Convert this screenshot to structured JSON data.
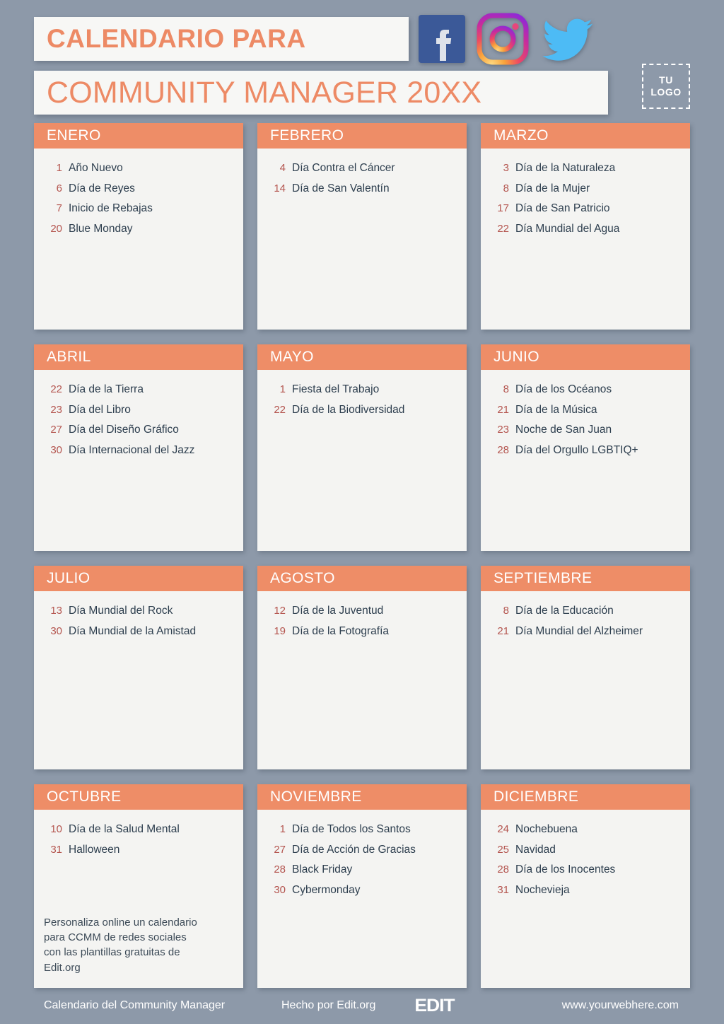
{
  "header": {
    "title_line1": "CALENDARIO PARA",
    "title_line2": "COMMUNITY MANAGER 20XX",
    "logo_line1": "TU",
    "logo_line2": "LOGO",
    "social_icons": [
      "facebook-icon",
      "instagram-icon",
      "twitter-icon"
    ]
  },
  "colors": {
    "background": "#8d99a9",
    "card": "#f4f4f2",
    "accent": "#ee8d67",
    "day_number": "#b4554f",
    "event_text": "#2d3e4e",
    "title_text": "#ed8a65"
  },
  "months": [
    {
      "name": "ENERO",
      "events": [
        {
          "day": "1",
          "label": "Año Nuevo"
        },
        {
          "day": "6",
          "label": "Día de Reyes"
        },
        {
          "day": "7",
          "label": "Inicio de Rebajas"
        },
        {
          "day": "20",
          "label": "Blue Monday"
        }
      ]
    },
    {
      "name": "FEBRERO",
      "events": [
        {
          "day": "4",
          "label": "Día Contra el Cáncer"
        },
        {
          "day": "14",
          "label": "Día de San Valentín"
        }
      ]
    },
    {
      "name": "MARZO",
      "events": [
        {
          "day": "3",
          "label": "Día de la Naturaleza"
        },
        {
          "day": "8",
          "label": "Día de la Mujer"
        },
        {
          "day": "17",
          "label": "Día de San Patricio"
        },
        {
          "day": "22",
          "label": "Día Mundial del Agua"
        }
      ]
    },
    {
      "name": "ABRIL",
      "events": [
        {
          "day": "22",
          "label": "Día de la Tierra"
        },
        {
          "day": "23",
          "label": "Día del Libro"
        },
        {
          "day": "27",
          "label": "Día del Diseño Gráfico"
        },
        {
          "day": "30",
          "label": "Día Internacional del Jazz"
        }
      ]
    },
    {
      "name": "MAYO",
      "events": [
        {
          "day": "1",
          "label": "Fiesta del Trabajo"
        },
        {
          "day": "22",
          "label": "Día de la Biodiversidad"
        }
      ]
    },
    {
      "name": "JUNIO",
      "events": [
        {
          "day": "8",
          "label": "Día de los Océanos"
        },
        {
          "day": "21",
          "label": "Día de la Música"
        },
        {
          "day": "23",
          "label": "Noche de San Juan"
        },
        {
          "day": "28",
          "label": "Día del Orgullo LGBTIQ+"
        }
      ]
    },
    {
      "name": "JULIO",
      "events": [
        {
          "day": "13",
          "label": "Día Mundial del Rock"
        },
        {
          "day": "30",
          "label": "Día Mundial de la Amistad"
        }
      ]
    },
    {
      "name": "AGOSTO",
      "events": [
        {
          "day": "12",
          "label": "Día de la Juventud"
        },
        {
          "day": "19",
          "label": "Día de la Fotografía"
        }
      ]
    },
    {
      "name": "SEPTIEMBRE",
      "events": [
        {
          "day": "8",
          "label": "Día de la Educación"
        },
        {
          "day": "21",
          "label": "Día Mundial del Alzheimer"
        }
      ]
    },
    {
      "name": "OCTUBRE",
      "events": [
        {
          "day": "10",
          "label": "Día de la Salud Mental"
        },
        {
          "day": "31",
          "label": "Halloween"
        }
      ],
      "promo": "Personaliza online un calendario\npara CCMM de redes sociales\ncon las plantillas gratuitas de\nEdit.org"
    },
    {
      "name": "NOVIEMBRE",
      "events": [
        {
          "day": "1",
          "label": "Día de Todos los Santos"
        },
        {
          "day": "27",
          "label": "Día de Acción de Gracias"
        },
        {
          "day": "28",
          "label": "Black Friday"
        },
        {
          "day": "30",
          "label": "Cybermonday"
        }
      ]
    },
    {
      "name": "DICIEMBRE",
      "events": [
        {
          "day": "24",
          "label": "Nochebuena"
        },
        {
          "day": "25",
          "label": "Navidad"
        },
        {
          "day": "28",
          "label": "Día de los Inocentes"
        },
        {
          "day": "31",
          "label": "Nochevieja"
        }
      ]
    }
  ],
  "footer": {
    "left": "Calendario del Community Manager",
    "middle": "Hecho por Edit.org",
    "brand": "EDIT",
    "right": "www.yourwebhere.com"
  }
}
